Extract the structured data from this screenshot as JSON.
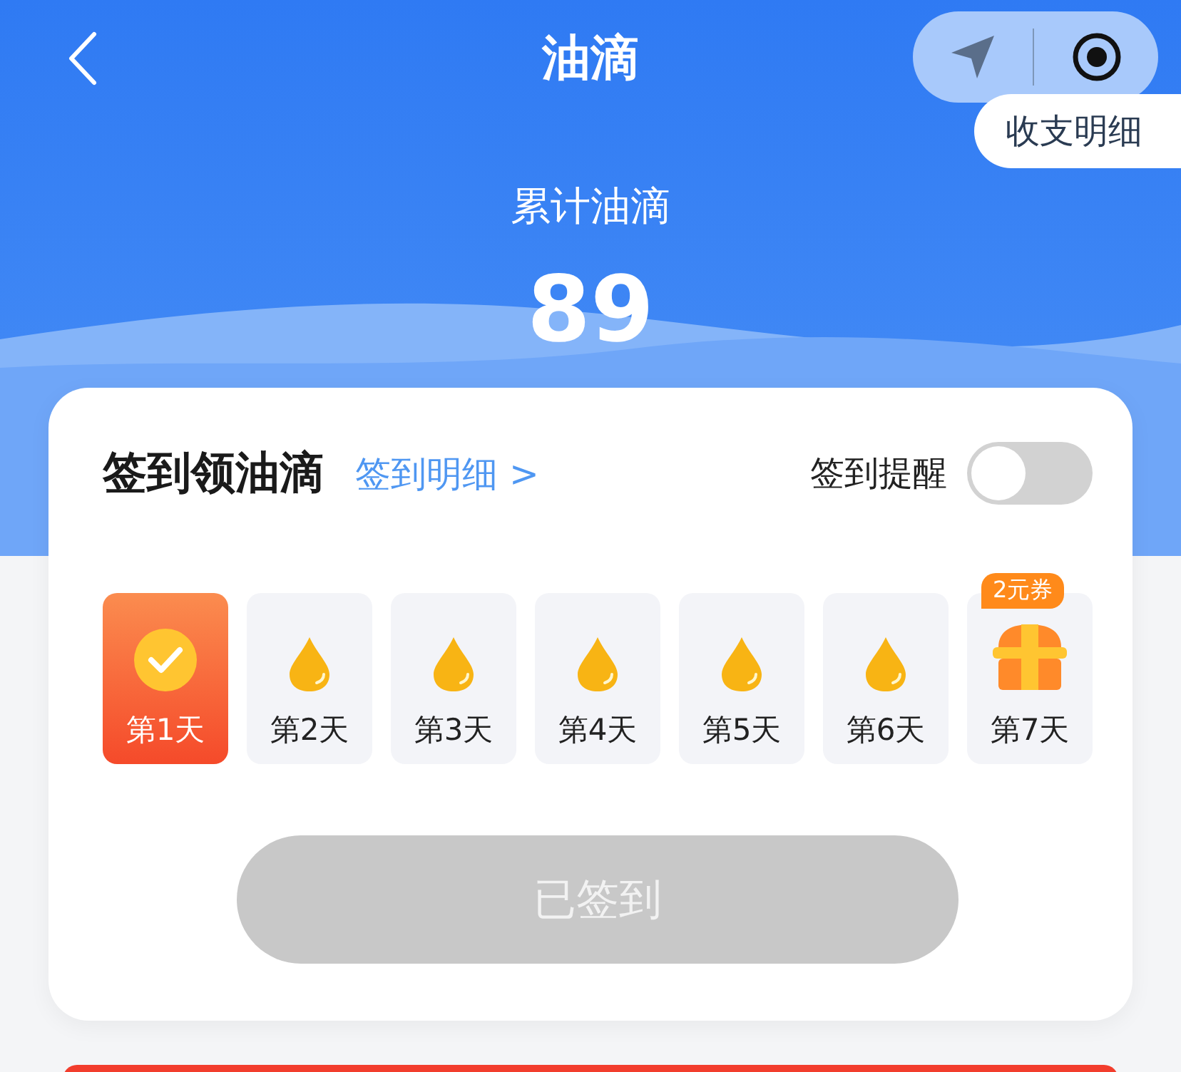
{
  "nav": {
    "title": "油滴",
    "details_link": "收支明细"
  },
  "summary": {
    "label": "累计油滴",
    "value": "89"
  },
  "checkin": {
    "title": "签到领油滴",
    "details_link": "签到明细 >",
    "reminder_label": "签到提醒",
    "reminder_on": false,
    "days": [
      {
        "label": "第1天",
        "kind": "done",
        "selected": true
      },
      {
        "label": "第2天",
        "kind": "drop",
        "selected": false
      },
      {
        "label": "第3天",
        "kind": "drop",
        "selected": false
      },
      {
        "label": "第4天",
        "kind": "drop",
        "selected": false
      },
      {
        "label": "第5天",
        "kind": "drop",
        "selected": false
      },
      {
        "label": "第6天",
        "kind": "drop",
        "selected": false
      },
      {
        "label": "第7天",
        "kind": "chest",
        "selected": false,
        "badge": "2元券"
      }
    ],
    "button": {
      "label": "已签到",
      "disabled": true
    }
  }
}
